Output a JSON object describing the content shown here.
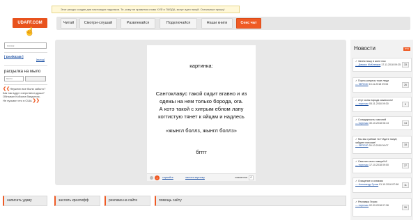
{
  "notice": "Этот ресурс создан для настоящих падонков. Те, кому не нравится слово ХУЙ и ПИЗДА, могут идти нахуй. Остальные прошу!",
  "logo": "UDAFF.COM",
  "nav": {
    "tabs": [
      "Читай",
      "Смотри-слушай",
      "Развлекайся",
      "Подключайся",
      "Наши книги",
      "Секс чат"
    ]
  },
  "sidebar": {
    "search_placeholder": "поиск",
    "user": "[ Devik0245 ]",
    "logout": "[выход]",
    "rassylka_title": "расцылка на мыло",
    "rassylka_placeholder": "мыло",
    "rumors": [
      "Неужели все были забыто?",
      "Как так вдруг очерствела душа?",
      "Обнывал Кобзона бандитом,",
      "Не пускают его в США"
    ]
  },
  "post": {
    "lines": [
      "картинка:",
      "",
      "",
      "Сантоклавус такой сидит вгавно и из",
      "одежы на нем только борода, ога.",
      "А котэ такой с хитрым еблом лапу",
      "когтистую тянет к яйцам и надлесь",
      "",
      "«жынгл боллз, жынгл боллз»",
      "",
      "бгггг"
    ],
    "controls": {
      "link1": "слушайте",
      "link2": "заслать картинку",
      "comments_label": "комментов",
      "comments_count": "0"
    }
  },
  "footer": [
    "написать удаву",
    "заслать креатифф",
    "реклама на сайте",
    "помощь сайту"
  ],
  "news": {
    "title": "Новости",
    "rss": "RSS",
    "items": [
      {
        "title": "Зачем пошу в жопе нож",
        "author": "Дамаск МсКлевков",
        "date": "17.11.2018 09:25",
        "count": "33"
      },
      {
        "title": "Порно-актрисы тоже люди",
        "author": "SERGIO",
        "date": "15.11.2018 09:06",
        "count": "26"
      },
      {
        "title": "Игут сыны народа казахского!",
        "author": "ecyruvac",
        "date": "05.11.2018 09:30",
        "count": "9"
      },
      {
        "title": "Солидарность хьюготей",
        "author": "ecyruvac",
        "date": "30.10.2018 06:13",
        "count": "14"
      },
      {
        "title": "Мы вас грабим! Чо? Идите нахуй, зайдите попозже!",
        "author": "SERGIO",
        "date": "26.10.2018 09:07",
        "count": "18"
      },
      {
        "title": "Свистать всех наверх!Ы!",
        "author": "ecyruvac",
        "date": "17.10.2018 09:00",
        "count": "27"
      },
      {
        "title": "Очищение и онанизм",
        "author": "Александр Гутаж",
        "date": "01.10.2018 07:58",
        "count": "11"
      },
      {
        "title": "Рекламка Герою",
        "author": "ecyruvac",
        "date": "02.09.2018 07:36",
        "count": "26"
      }
    ]
  }
}
